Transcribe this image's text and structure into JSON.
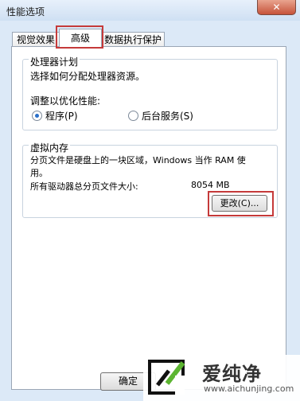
{
  "window": {
    "title": "性能选项",
    "close_label": "✕"
  },
  "tabs": [
    {
      "label": "视觉效果"
    },
    {
      "label": "高级"
    },
    {
      "label": "数据执行保护"
    }
  ],
  "processor_group": {
    "title": "处理器计划",
    "description": "选择如何分配处理器资源。",
    "adjust_label": "调整以优化性能:",
    "options": [
      {
        "label": "程序(P)",
        "checked": true
      },
      {
        "label": "后台服务(S)",
        "checked": false
      }
    ]
  },
  "vm_group": {
    "title": "虚拟内存",
    "description": "分页文件是硬盘上的一块区域，Windows 当作 RAM 使",
    "description_line2": "用。",
    "total_label": "所有驱动器总分页文件大小:",
    "total_value": "8054 MB",
    "change_button": "更改(C)..."
  },
  "buttons": {
    "ok": "确定"
  },
  "watermark": {
    "brand": "爱纯净",
    "url": "www.aichunjing.com"
  },
  "colors": {
    "highlight": "#c53a3a",
    "accent": "#2a6fc9"
  }
}
